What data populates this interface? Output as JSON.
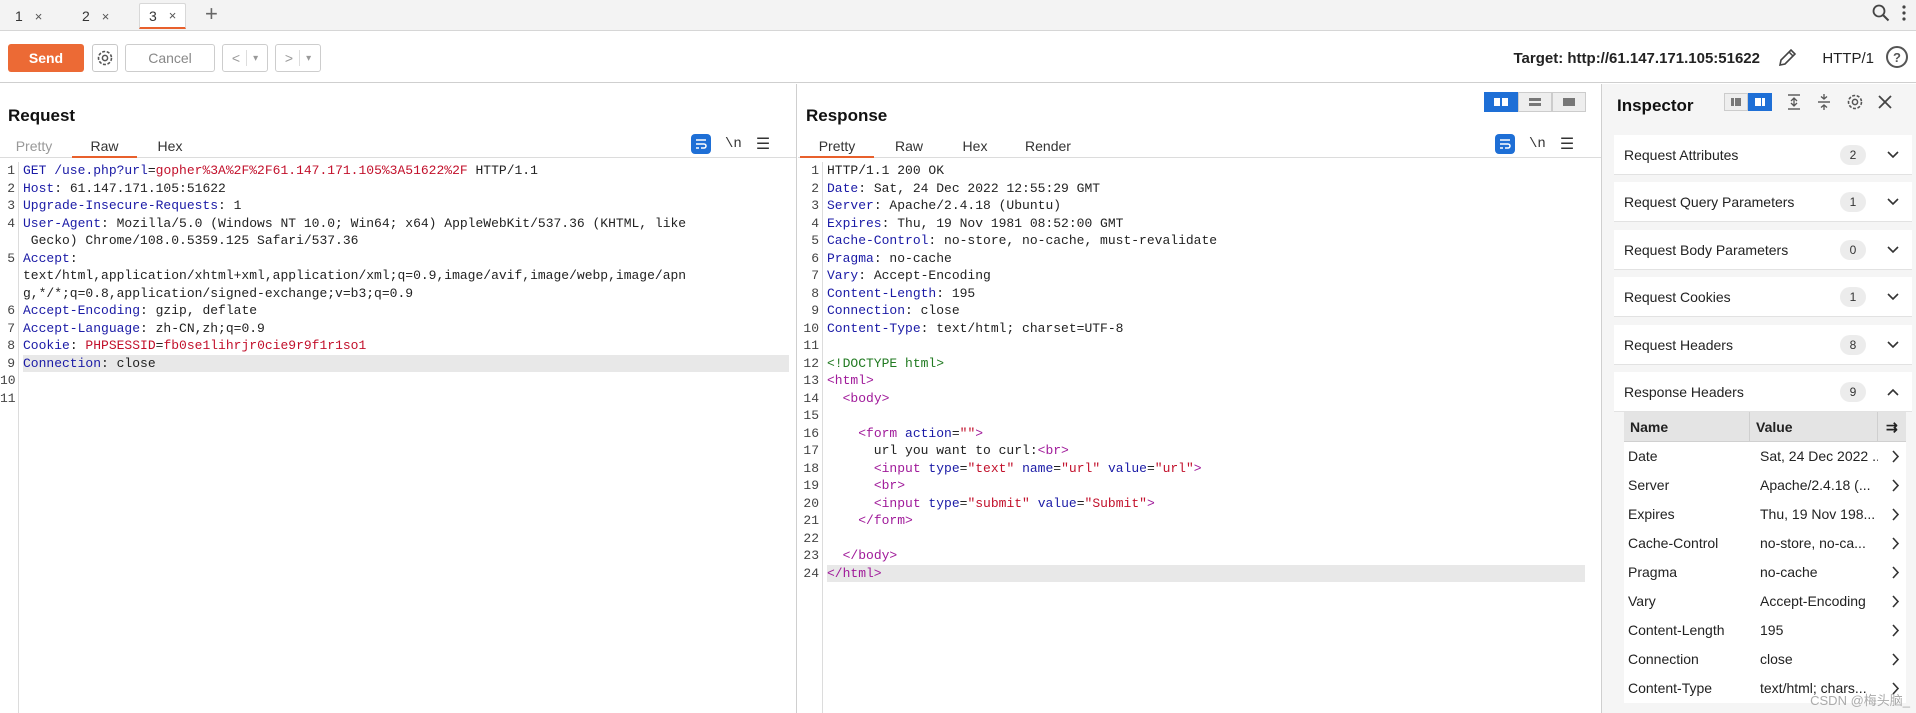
{
  "tabs": [
    {
      "label": "1",
      "close": "×"
    },
    {
      "label": "2",
      "close": "×"
    },
    {
      "label": "3",
      "close": "×"
    }
  ],
  "tab_add": "+",
  "toolbar": {
    "send": "Send",
    "cancel": "Cancel",
    "back": "<",
    "forward": ">",
    "dropdown": "▾",
    "target": "Target: http://61.147.171.105:51622",
    "http_version": "HTTP/1",
    "help": "?"
  },
  "request": {
    "title": "Request",
    "tabs": [
      "Pretty",
      "Raw",
      "Hex"
    ],
    "active_tab": "Raw",
    "newline_toggle": "\\n",
    "lines": [
      [
        [
          "k",
          "GET /use.php?"
        ],
        [
          "attr",
          "url"
        ],
        [
          "v",
          "="
        ],
        [
          "r",
          "gopher%3A%2F%2F61.147.171.105%3A51622%2F"
        ],
        [
          "v",
          " HTTP/1.1"
        ]
      ],
      [
        [
          "k",
          "Host"
        ],
        [
          "v",
          ": 61.147.171.105:51622"
        ]
      ],
      [
        [
          "k",
          "Upgrade-Insecure-Requests"
        ],
        [
          "v",
          ": 1"
        ]
      ],
      [
        [
          "k",
          "User-Agent"
        ],
        [
          "v",
          ": Mozilla/5.0 (Windows NT 10.0; Win64; x64) AppleWebKit/537.36 (KHTML, like"
        ]
      ],
      [
        [
          "v",
          " Gecko) Chrome/108.0.5359.125 Safari/537.36"
        ]
      ],
      [
        [
          "k",
          "Accept"
        ],
        [
          "v",
          ":"
        ]
      ],
      [
        [
          "v",
          "text/html,application/xhtml+xml,application/xml;q=0.9,image/avif,image/webp,image/apn"
        ]
      ],
      [
        [
          "v",
          "g,*/*;q=0.8,application/signed-exchange;v=b3;q=0.9"
        ]
      ],
      [
        [
          "k",
          "Accept-Encoding"
        ],
        [
          "v",
          ": gzip, deflate"
        ]
      ],
      [
        [
          "k",
          "Accept-Language"
        ],
        [
          "v",
          ": zh-CN,zh;q=0.9"
        ]
      ],
      [
        [
          "k",
          "Cookie"
        ],
        [
          "v",
          ": "
        ],
        [
          "r",
          "PHPSESSID"
        ],
        [
          "v",
          "="
        ],
        [
          "r",
          "fb0se1lihrjr0cie9r9f1r1so1"
        ]
      ],
      [
        [
          "k",
          "Connection"
        ],
        [
          "v",
          ": close"
        ]
      ],
      [],
      []
    ],
    "line_numbers": [
      "1",
      "2",
      "3",
      "4",
      "",
      "5",
      "",
      "",
      "6",
      "7",
      "8",
      "9",
      "10",
      "11"
    ],
    "highlight_line": 11
  },
  "response": {
    "title": "Response",
    "tabs": [
      "Pretty",
      "Raw",
      "Hex",
      "Render"
    ],
    "active_tab": "Pretty",
    "newline_toggle": "\\n",
    "lines": [
      [
        [
          "v",
          "HTTP/1.1 200 OK"
        ]
      ],
      [
        [
          "k",
          "Date"
        ],
        [
          "v",
          ": Sat, 24 Dec 2022 12:55:29 GMT"
        ]
      ],
      [
        [
          "k",
          "Server"
        ],
        [
          "v",
          ": Apache/2.4.18 (Ubuntu)"
        ]
      ],
      [
        [
          "k",
          "Expires"
        ],
        [
          "v",
          ": Thu, 19 Nov 1981 08:52:00 GMT"
        ]
      ],
      [
        [
          "k",
          "Cache-Control"
        ],
        [
          "v",
          ": no-store, no-cache, must-revalidate"
        ]
      ],
      [
        [
          "k",
          "Pragma"
        ],
        [
          "v",
          ": no-cache"
        ]
      ],
      [
        [
          "k",
          "Vary"
        ],
        [
          "v",
          ": Accept-Encoding"
        ]
      ],
      [
        [
          "k",
          "Content-Length"
        ],
        [
          "v",
          ": 195"
        ]
      ],
      [
        [
          "k",
          "Connection"
        ],
        [
          "v",
          ": close"
        ]
      ],
      [
        [
          "k",
          "Content-Type"
        ],
        [
          "v",
          ": text/html; charset=UTF-8"
        ]
      ],
      [],
      [
        [
          "g",
          "<!DOCTYPE html>"
        ]
      ],
      [
        [
          "tag",
          "<html>"
        ]
      ],
      [
        [
          "pl",
          "  "
        ],
        [
          "tag",
          "<body>"
        ]
      ],
      [],
      [
        [
          "pl",
          "    "
        ],
        [
          "tag",
          "<form "
        ],
        [
          "attr",
          "action"
        ],
        [
          "pl",
          "="
        ],
        [
          "str",
          "\"\""
        ],
        [
          "tag",
          ">"
        ]
      ],
      [
        [
          "pl",
          "      url you want to curl:"
        ],
        [
          "tag",
          "<br>"
        ]
      ],
      [
        [
          "pl",
          "      "
        ],
        [
          "tag",
          "<input "
        ],
        [
          "attr",
          "type"
        ],
        [
          "pl",
          "="
        ],
        [
          "str",
          "\"text\""
        ],
        [
          "pl",
          " "
        ],
        [
          "attr",
          "name"
        ],
        [
          "pl",
          "="
        ],
        [
          "str",
          "\"url\""
        ],
        [
          "pl",
          " "
        ],
        [
          "attr",
          "value"
        ],
        [
          "pl",
          "="
        ],
        [
          "str",
          "\"url\""
        ],
        [
          "tag",
          ">"
        ]
      ],
      [
        [
          "pl",
          "      "
        ],
        [
          "tag",
          "<br>"
        ]
      ],
      [
        [
          "pl",
          "      "
        ],
        [
          "tag",
          "<input "
        ],
        [
          "attr",
          "type"
        ],
        [
          "pl",
          "="
        ],
        [
          "str",
          "\"submit\""
        ],
        [
          "pl",
          " "
        ],
        [
          "attr",
          "value"
        ],
        [
          "pl",
          "="
        ],
        [
          "str",
          "\"Submit\""
        ],
        [
          "tag",
          ">"
        ]
      ],
      [
        [
          "pl",
          "    "
        ],
        [
          "tag",
          "</form>"
        ]
      ],
      [],
      [
        [
          "pl",
          "  "
        ],
        [
          "tag",
          "</body>"
        ]
      ],
      [
        [
          "tag",
          "</html>"
        ]
      ]
    ],
    "highlight_line": 23
  },
  "inspector": {
    "title": "Inspector",
    "sections": [
      {
        "label": "Request Attributes",
        "count": "2"
      },
      {
        "label": "Request Query Parameters",
        "count": "1"
      },
      {
        "label": "Request Body Parameters",
        "count": "0"
      },
      {
        "label": "Request Cookies",
        "count": "1"
      },
      {
        "label": "Request Headers",
        "count": "8"
      },
      {
        "label": "Response Headers",
        "count": "9"
      }
    ],
    "table_headers": {
      "name": "Name",
      "value": "Value"
    },
    "response_headers": [
      {
        "name": "Date",
        "value": "Sat, 24 Dec 2022 ..."
      },
      {
        "name": "Server",
        "value": "Apache/2.4.18 (..."
      },
      {
        "name": "Expires",
        "value": "Thu, 19 Nov 198..."
      },
      {
        "name": "Cache-Control",
        "value": "no-store, no-ca..."
      },
      {
        "name": "Pragma",
        "value": "no-cache"
      },
      {
        "name": "Vary",
        "value": "Accept-Encoding"
      },
      {
        "name": "Content-Length",
        "value": "195"
      },
      {
        "name": "Connection",
        "value": "close"
      },
      {
        "name": "Content-Type",
        "value": "text/html; chars..."
      }
    ]
  },
  "watermark": "CSDN @梅头脑_",
  "colors": {
    "accent": "#e8602c",
    "send": "#ec6a35",
    "blue": "#1e6fd6"
  }
}
